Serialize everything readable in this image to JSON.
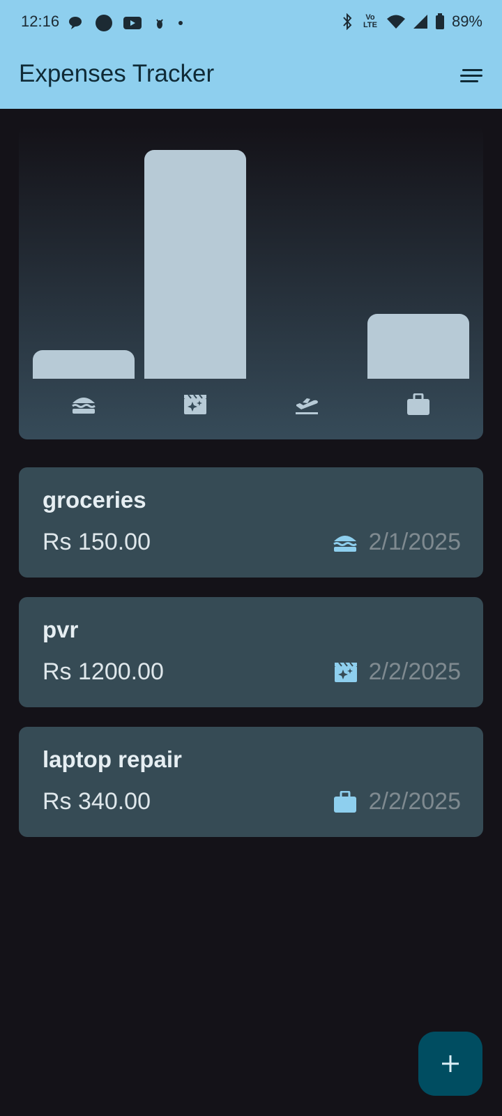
{
  "status_bar": {
    "time": "12:16",
    "battery": "89%",
    "network_label": "Vo LTE"
  },
  "app_bar": {
    "title": "Expenses Tracker",
    "menu_icon": "sort-icon"
  },
  "chart_data": {
    "type": "bar",
    "categories": [
      "food",
      "leisure",
      "travel",
      "work"
    ],
    "category_icons": [
      "burger-icon",
      "movie-icon",
      "flight-takeoff-icon",
      "briefcase-icon"
    ],
    "values": [
      150,
      1200,
      0,
      340
    ],
    "colors": {
      "bar": "#b7cad6"
    }
  },
  "expenses": [
    {
      "title": "groceries",
      "amount": "Rs 150.00",
      "date": "2/1/2025",
      "category_icon": "burger-icon"
    },
    {
      "title": "pvr",
      "amount": "Rs 1200.00",
      "date": "2/2/2025",
      "category_icon": "movie-icon"
    },
    {
      "title": "laptop repair",
      "amount": "Rs 340.00",
      "date": "2/2/2025",
      "category_icon": "briefcase-icon"
    }
  ],
  "fab": {
    "icon": "plus-icon"
  },
  "colors": {
    "app_bar": "#8ecfee",
    "background": "#141218",
    "card": "#364b55",
    "accent_icon": "#8ecfee",
    "fab": "#004d61"
  }
}
